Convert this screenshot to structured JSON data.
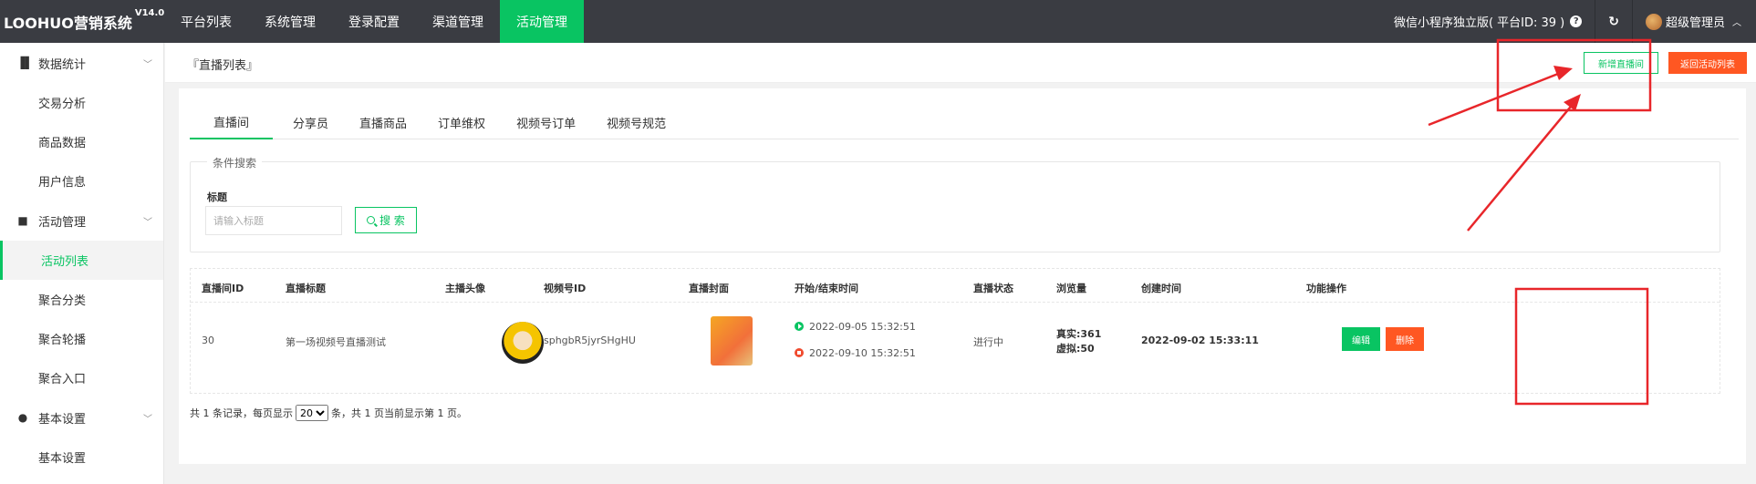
{
  "app": {
    "logo": "LOOHUO营销系统",
    "version": "V14.0"
  },
  "nav": [
    {
      "label": "平台列表"
    },
    {
      "label": "系统管理"
    },
    {
      "label": "登录配置"
    },
    {
      "label": "渠道管理"
    },
    {
      "label": "活动管理",
      "active": true
    }
  ],
  "topright": {
    "platform": "微信小程序独立版( 平台ID: 39 )",
    "user": "超级管理员"
  },
  "sidebar": {
    "group1": "数据统计",
    "g1_items": [
      "交易分析",
      "商品数据",
      "用户信息"
    ],
    "group2": "活动管理",
    "g2_items": [
      "活动列表",
      "聚合分类",
      "聚合轮播",
      "聚合入口"
    ],
    "group3": "基本设置",
    "g3_items": [
      "基本设置"
    ]
  },
  "page": {
    "breadcrumb": "『直播列表』",
    "new_button": "新增直播间",
    "back_button": "返回活动列表"
  },
  "tabs": [
    "直播间",
    "分享员",
    "直播商品",
    "订单维权",
    "视频号订单",
    "视频号规范"
  ],
  "search": {
    "legend": "条件搜索",
    "label": "标题",
    "placeholder": "请输入标题",
    "button": "搜 索"
  },
  "table": {
    "headers": [
      "直播间ID",
      "直播标题",
      "主播头像",
      "视频号ID",
      "直播封面",
      "开始/结束时间",
      "直播状态",
      "浏览量",
      "创建时间",
      "功能操作"
    ],
    "rows": [
      {
        "id": "30",
        "title": "第一场视频号直播测试",
        "video_id": "sphgbR5jyrSHgHU",
        "start": "2022-09-05 15:32:51",
        "end": "2022-09-10 15:32:51",
        "status": "进行中",
        "views_real": "真实:361",
        "views_fake": "虚拟:50",
        "created": "2022-09-02 15:33:11",
        "edit": "编辑",
        "delete": "删除"
      }
    ]
  },
  "pager": {
    "prefix": "共 1 条记录，每页显示",
    "page_size": "20",
    "suffix": "条，共 1 页当前显示第 1 页。"
  },
  "colors": {
    "accent": "#09c462",
    "danger": "#ff5722",
    "topbar": "#3a3c42",
    "annotation": "#e8262a"
  }
}
